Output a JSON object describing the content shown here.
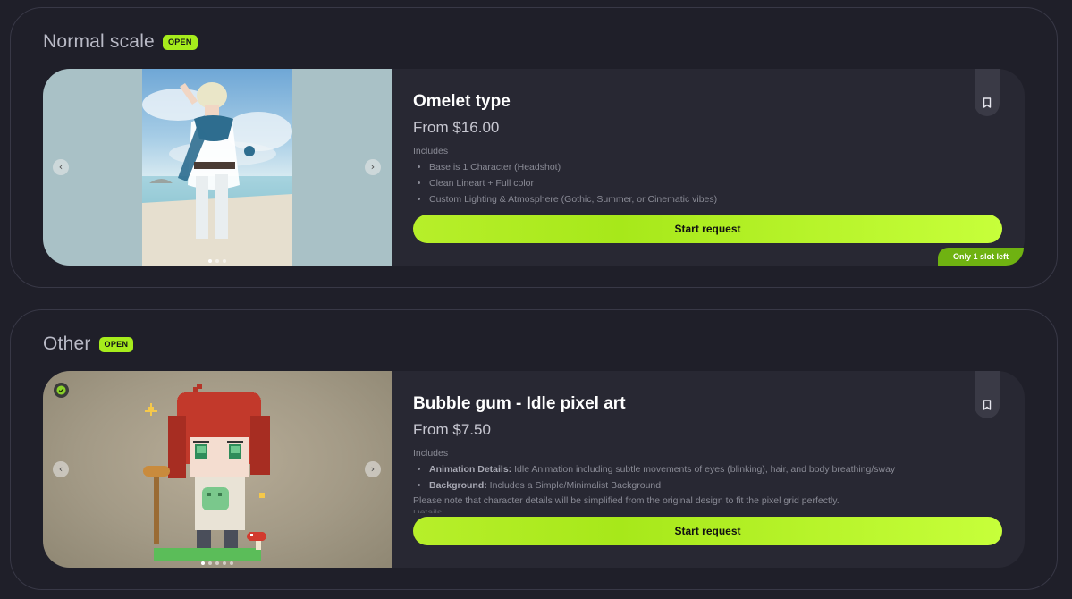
{
  "colors": {
    "page_bg": "#1f1f29",
    "card_bg": "#282833",
    "accent": "#a6ec1c",
    "slot_badge": "#6fb211"
  },
  "sections": [
    {
      "title": "Normal scale",
      "badge": "OPEN",
      "card": {
        "title": "Omelet type",
        "price": "From $16.00",
        "includes_label": "Includes",
        "includes": [
          "Base is 1 Character (Headshot)",
          "Clean Lineart + Full color",
          "Custom Lighting & Atmosphere (Gothic, Summer, or Cinematic vibes)"
        ],
        "button": "Start request",
        "slot_badge": "Only 1 slot left",
        "carousel": {
          "image_count": 3,
          "active_index": 0,
          "prev_icon": "chevron-left-icon",
          "next_icon": "chevron-right-icon"
        },
        "bookmark_icon": "bookmark-icon"
      }
    },
    {
      "title": "Other",
      "badge": "OPEN",
      "card": {
        "title": "Bubble gum - Idle pixel art",
        "price": "From $7.50",
        "includes_label": "Includes",
        "includes": [
          {
            "label": "Animation Details:",
            "text": " Idle Animation including subtle movements of eyes (blinking), hair, and body breathing/sway"
          },
          {
            "label": "Background:",
            "text": " Includes a Simple/Minimalist Background"
          }
        ],
        "note": "Please note that character details will be simplified from the original design to fit the pixel grid perfectly.",
        "note_cut": "Details",
        "button": "Start request",
        "carousel": {
          "image_count": 5,
          "active_index": 0,
          "prev_icon": "chevron-left-icon",
          "next_icon": "chevron-right-icon"
        },
        "verified_icon": "verified-check-icon",
        "bookmark_icon": "bookmark-icon"
      }
    }
  ]
}
